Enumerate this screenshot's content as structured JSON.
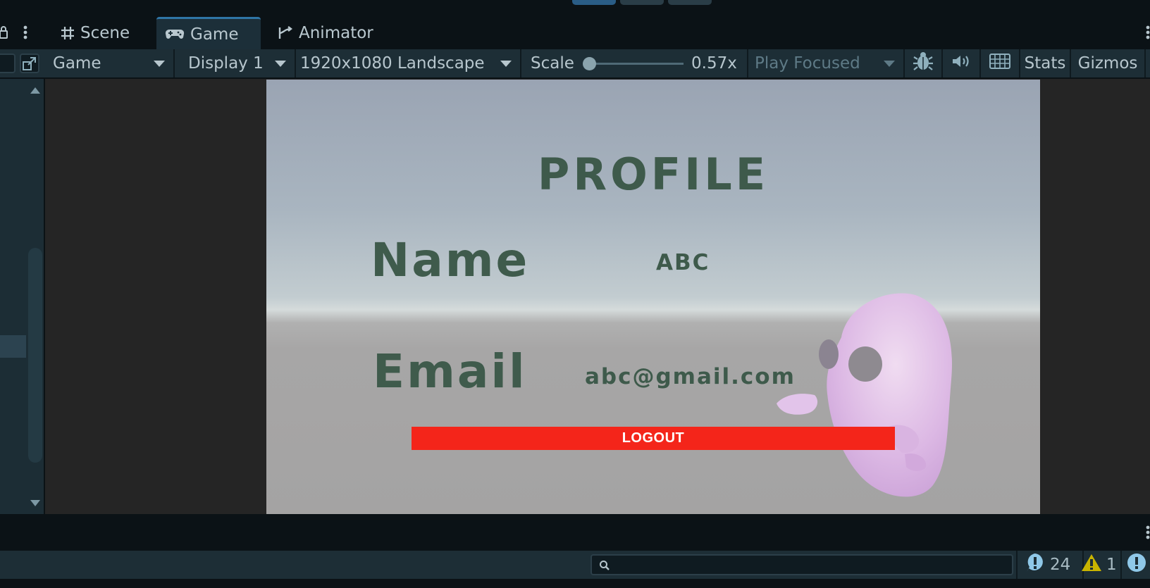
{
  "tabs": [
    {
      "label": "Scene",
      "icon": "grid-icon",
      "active": false
    },
    {
      "label": "Game",
      "icon": "gamepad-icon",
      "active": true
    },
    {
      "label": "Animator",
      "icon": "animator-icon",
      "active": false
    }
  ],
  "toolbar": {
    "view_select": "Game",
    "display_select": "Display 1",
    "resolution_select": "1920x1080 Landscape",
    "scale_label": "Scale",
    "scale_value": "0.57x",
    "scale_fraction": 0.0,
    "play_mode_select": "Play Focused",
    "stats_label": "Stats",
    "gizmos_label": "Gizmos"
  },
  "game": {
    "title": "PROFILE",
    "name_label": "Name",
    "name_value": "ABC",
    "email_label": "Email",
    "email_value": "abc@gmail.com",
    "logout_label": "LOGOUT"
  },
  "console": {
    "search_placeholder": "",
    "info_count": "24",
    "warning_count": "1"
  },
  "colors": {
    "accent_tab": "#2f75a6",
    "logout_button": "#f4251a",
    "text_green": "#3e5a4b",
    "warning_yellow": "#c8b400",
    "info_blue": "#8fc8e8"
  }
}
